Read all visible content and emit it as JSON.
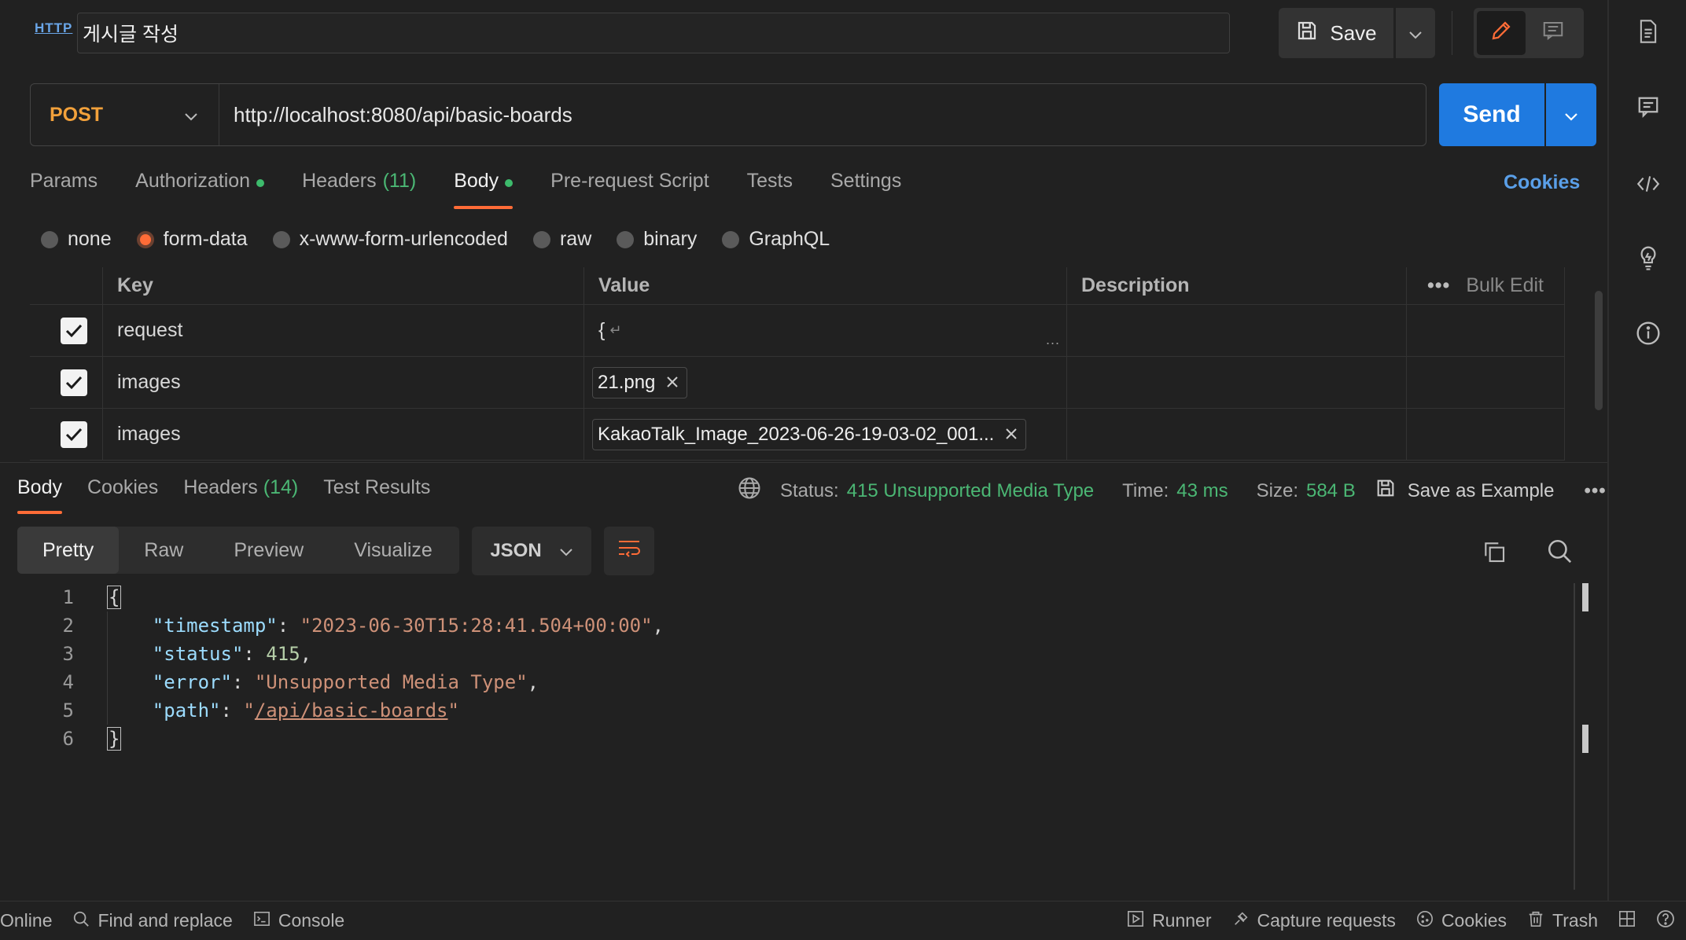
{
  "request": {
    "protocol_icon": "HTTP",
    "name": "게시글 작성",
    "save_label": "Save",
    "method": "POST",
    "url": "http://localhost:8080/api/basic-boards",
    "send_label": "Send"
  },
  "req_tabs": {
    "params": "Params",
    "authorization": "Authorization",
    "headers": "Headers",
    "headers_count": "(11)",
    "body": "Body",
    "pre_request": "Pre-request Script",
    "tests": "Tests",
    "settings": "Settings",
    "cookies": "Cookies"
  },
  "body_types": {
    "none": "none",
    "form_data": "form-data",
    "urlencoded": "x-www-form-urlencoded",
    "raw": "raw",
    "binary": "binary",
    "graphql": "GraphQL",
    "selected": "form-data"
  },
  "form_table": {
    "headers": {
      "key": "Key",
      "value": "Value",
      "description": "Description",
      "bulk_edit": "Bulk Edit"
    },
    "rows": [
      {
        "key": "request",
        "value": "{",
        "checked": true
      },
      {
        "key": "images",
        "value": "21.png",
        "checked": true
      },
      {
        "key": "images",
        "value": "KakaoTalk_Image_2023-06-26-19-03-02_001...",
        "checked": true
      }
    ]
  },
  "response": {
    "tabs": {
      "body": "Body",
      "cookies": "Cookies",
      "headers": "Headers",
      "headers_count": "(14)",
      "test_results": "Test Results"
    },
    "status_label": "Status:",
    "status_value": "415 Unsupported Media Type",
    "time_label": "Time:",
    "time_value": "43 ms",
    "size_label": "Size:",
    "size_value": "584 B",
    "save_example": "Save as Example",
    "views": {
      "pretty": "Pretty",
      "raw": "Raw",
      "preview": "Preview",
      "visualize": "Visualize"
    },
    "format": "JSON",
    "body_json": {
      "timestamp_key": "\"timestamp\"",
      "timestamp_val": "\"2023-06-30T15:28:41.504+00:00\"",
      "status_key": "\"status\"",
      "status_val": "415",
      "error_key": "\"error\"",
      "error_val": "\"Unsupported Media Type\"",
      "path_key": "\"path\"",
      "path_open_quote": "\"",
      "path_link": "/api/basic-boards",
      "path_close_quote": "\""
    }
  },
  "status_bar": {
    "online": "Online",
    "find_replace": "Find and replace",
    "console": "Console",
    "runner": "Runner",
    "capture": "Capture requests",
    "cookies": "Cookies",
    "trash": "Trash"
  },
  "colors": {
    "accent_orange": "#ff6c37",
    "send_blue": "#1f7ae0",
    "status_green": "#4bb774",
    "method_post": "#f2a13b"
  }
}
